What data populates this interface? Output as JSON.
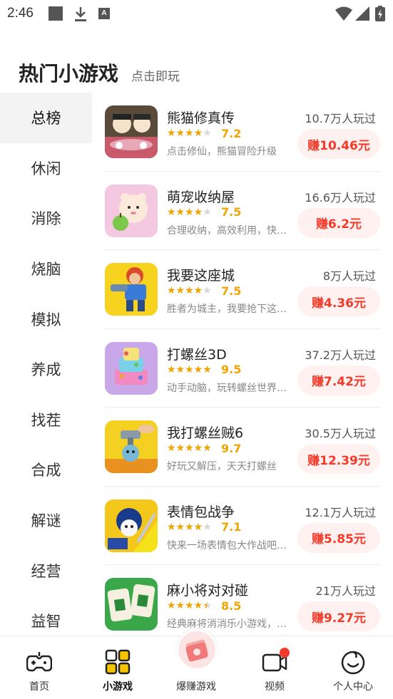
{
  "status_bar": {
    "time": "2:46",
    "a_icon_letter": "A",
    "icons": [
      "square-notification-icon",
      "download-icon",
      "a-icon",
      "wifi-icon",
      "cellular-icon",
      "battery-icon"
    ]
  },
  "header": {
    "title": "热门小游戏",
    "subtitle": "点击即玩"
  },
  "sidebar": {
    "items": [
      {
        "label": "总榜",
        "active": true
      },
      {
        "label": "休闲"
      },
      {
        "label": "消除"
      },
      {
        "label": "烧脑"
      },
      {
        "label": "模拟"
      },
      {
        "label": "养成"
      },
      {
        "label": "找茬"
      },
      {
        "label": "合成"
      },
      {
        "label": "解谜"
      },
      {
        "label": "经营"
      },
      {
        "label": "益智"
      }
    ]
  },
  "games": [
    {
      "name": "熊猫修真传",
      "plays": "10.7万人玩过",
      "stars": 3.5,
      "rating": "7.2",
      "desc": "点击修仙，熊猫冒险升级",
      "earn": "赚10.46元"
    },
    {
      "name": "萌宠收纳屋",
      "plays": "16.6万人玩过",
      "stars": 3.5,
      "rating": "7.5",
      "desc": "合理收纳，高效利用，快…",
      "earn": "赚6.2元"
    },
    {
      "name": "我要这座城",
      "plays": "8万人玩过",
      "stars": 3.5,
      "rating": "7.5",
      "desc": "胜者为城主，我要抢下这…",
      "earn": "赚4.36元"
    },
    {
      "name": "打螺丝3D",
      "plays": "37.2万人玩过",
      "stars": 4.5,
      "rating": "9.5",
      "desc": "动手动脑，玩转螺丝世界…",
      "earn": "赚7.42元"
    },
    {
      "name": "我打螺丝贼6",
      "plays": "30.5万人玩过",
      "stars": 4.5,
      "rating": "9.7",
      "desc": "好玩又解压，天天打螺丝",
      "earn": "赚12.39元"
    },
    {
      "name": "表情包战争",
      "plays": "12.1万人玩过",
      "stars": 3.5,
      "rating": "7.1",
      "desc": "快来一场表情包大作战吧…",
      "earn": "赚5.85元"
    },
    {
      "name": "麻小将对对碰",
      "plays": "21万人玩过",
      "stars": 4,
      "rating": "8.5",
      "desc": "经典麻将消消乐小游戏，…",
      "earn": "赚9.27元"
    }
  ],
  "bottom_nav": [
    {
      "label": "首页",
      "icon": "gamepad-icon"
    },
    {
      "label": "小游戏",
      "icon": "grid-icon",
      "active": true
    },
    {
      "label": "爆赚游戏",
      "icon": "money-icon"
    },
    {
      "label": "视频",
      "icon": "video-icon"
    },
    {
      "label": "个人中心",
      "icon": "smile-icon"
    }
  ],
  "colors": {
    "accent_red": "#f23a2a",
    "star_gold": "#f0a500",
    "earn_bg": "#fff1ef",
    "active_tab_bg": "#f3f3f3",
    "grid_yellow": "#f5c400"
  }
}
